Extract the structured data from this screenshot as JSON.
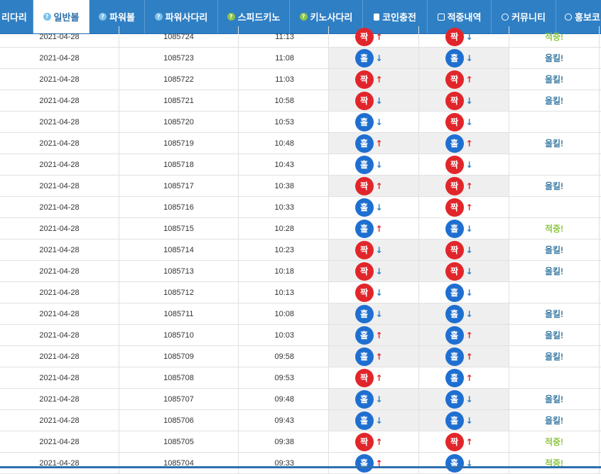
{
  "nav": {
    "items": [
      {
        "label": "리다리",
        "icon": "none",
        "active": false
      },
      {
        "label": "일반볼",
        "icon": "question-icon",
        "active": true
      },
      {
        "label": "파워볼",
        "icon": "question-icon",
        "active": false
      },
      {
        "label": "파워사다리",
        "icon": "question-icon",
        "active": false
      },
      {
        "label": "스피드키노",
        "icon": "question-icon-green",
        "active": false
      },
      {
        "label": "키노사다리",
        "icon": "question-icon-green",
        "active": false
      },
      {
        "label": "코인충전",
        "icon": "database-icon",
        "active": false
      },
      {
        "label": "적중내역",
        "icon": "checkbox-icon",
        "active": false
      },
      {
        "label": "커뮤니티",
        "icon": "smiley-icon",
        "active": false
      },
      {
        "label": "홍보코",
        "icon": "smiley-icon",
        "active": false
      }
    ]
  },
  "colors": {
    "nav_bg": "#2f7fc4",
    "odd_ball": "#1f6fd1",
    "even_ball": "#e1262b",
    "win_text": "#8cc63f",
    "lose_text": "#3a7aa3"
  },
  "table": {
    "rows": [
      {
        "date": "2021-04-28",
        "round": "1085724",
        "time": "11:13",
        "result": "짝",
        "result_arrow": "up",
        "pick": "짝",
        "pick_arrow": "down",
        "hit": "적중!",
        "hit_type": "win"
      },
      {
        "date": "2021-04-28",
        "round": "1085723",
        "time": "11:08",
        "result": "홀",
        "result_arrow": "down",
        "pick": "홀",
        "pick_arrow": "down",
        "hit": "올킬!",
        "hit_type": "lose"
      },
      {
        "date": "2021-04-28",
        "round": "1085722",
        "time": "11:03",
        "result": "짝",
        "result_arrow": "up",
        "pick": "짝",
        "pick_arrow": "up",
        "hit": "올킬!",
        "hit_type": "lose"
      },
      {
        "date": "2021-04-28",
        "round": "1085721",
        "time": "10:58",
        "result": "짝",
        "result_arrow": "down",
        "pick": "짝",
        "pick_arrow": "down",
        "hit": "올킬!",
        "hit_type": "lose"
      },
      {
        "date": "2021-04-28",
        "round": "1085720",
        "time": "10:53",
        "result": "홀",
        "result_arrow": "down",
        "pick": "짝",
        "pick_arrow": "down",
        "hit": "",
        "hit_type": "none"
      },
      {
        "date": "2021-04-28",
        "round": "1085719",
        "time": "10:48",
        "result": "홀",
        "result_arrow": "up",
        "pick": "홀",
        "pick_arrow": "up",
        "hit": "올킬!",
        "hit_type": "lose"
      },
      {
        "date": "2021-04-28",
        "round": "1085718",
        "time": "10:43",
        "result": "홀",
        "result_arrow": "down",
        "pick": "짝",
        "pick_arrow": "down",
        "hit": "",
        "hit_type": "none"
      },
      {
        "date": "2021-04-28",
        "round": "1085717",
        "time": "10:38",
        "result": "짝",
        "result_arrow": "up",
        "pick": "짝",
        "pick_arrow": "up",
        "hit": "올킬!",
        "hit_type": "lose"
      },
      {
        "date": "2021-04-28",
        "round": "1085716",
        "time": "10:33",
        "result": "홀",
        "result_arrow": "down",
        "pick": "짝",
        "pick_arrow": "up",
        "hit": "",
        "hit_type": "none"
      },
      {
        "date": "2021-04-28",
        "round": "1085715",
        "time": "10:28",
        "result": "홀",
        "result_arrow": "up",
        "pick": "홀",
        "pick_arrow": "down",
        "hit": "적중!",
        "hit_type": "win"
      },
      {
        "date": "2021-04-28",
        "round": "1085714",
        "time": "10:23",
        "result": "짝",
        "result_arrow": "down",
        "pick": "짝",
        "pick_arrow": "down",
        "hit": "올킬!",
        "hit_type": "lose"
      },
      {
        "date": "2021-04-28",
        "round": "1085713",
        "time": "10:18",
        "result": "짝",
        "result_arrow": "down",
        "pick": "짝",
        "pick_arrow": "down",
        "hit": "올킬!",
        "hit_type": "lose"
      },
      {
        "date": "2021-04-28",
        "round": "1085712",
        "time": "10:13",
        "result": "짝",
        "result_arrow": "down",
        "pick": "홀",
        "pick_arrow": "down",
        "hit": "",
        "hit_type": "none"
      },
      {
        "date": "2021-04-28",
        "round": "1085711",
        "time": "10:08",
        "result": "홀",
        "result_arrow": "down",
        "pick": "홀",
        "pick_arrow": "down",
        "hit": "올킬!",
        "hit_type": "lose"
      },
      {
        "date": "2021-04-28",
        "round": "1085710",
        "time": "10:03",
        "result": "홀",
        "result_arrow": "up",
        "pick": "홀",
        "pick_arrow": "up",
        "hit": "올킬!",
        "hit_type": "lose"
      },
      {
        "date": "2021-04-28",
        "round": "1085709",
        "time": "09:58",
        "result": "홀",
        "result_arrow": "up",
        "pick": "홀",
        "pick_arrow": "up",
        "hit": "올킬!",
        "hit_type": "lose"
      },
      {
        "date": "2021-04-28",
        "round": "1085708",
        "time": "09:53",
        "result": "짝",
        "result_arrow": "up",
        "pick": "홀",
        "pick_arrow": "up",
        "hit": "",
        "hit_type": "none"
      },
      {
        "date": "2021-04-28",
        "round": "1085707",
        "time": "09:48",
        "result": "홀",
        "result_arrow": "down",
        "pick": "홀",
        "pick_arrow": "down",
        "hit": "올킬!",
        "hit_type": "lose"
      },
      {
        "date": "2021-04-28",
        "round": "1085706",
        "time": "09:43",
        "result": "홀",
        "result_arrow": "down",
        "pick": "홀",
        "pick_arrow": "down",
        "hit": "올킬!",
        "hit_type": "lose"
      },
      {
        "date": "2021-04-28",
        "round": "1085705",
        "time": "09:38",
        "result": "짝",
        "result_arrow": "up",
        "pick": "짝",
        "pick_arrow": "up",
        "hit": "적중!",
        "hit_type": "win"
      },
      {
        "date": "2021-04-28",
        "round": "1085704",
        "time": "09:33",
        "result": "홀",
        "result_arrow": "up",
        "pick": "홀",
        "pick_arrow": "down",
        "hit": "적중!",
        "hit_type": "win"
      }
    ]
  }
}
